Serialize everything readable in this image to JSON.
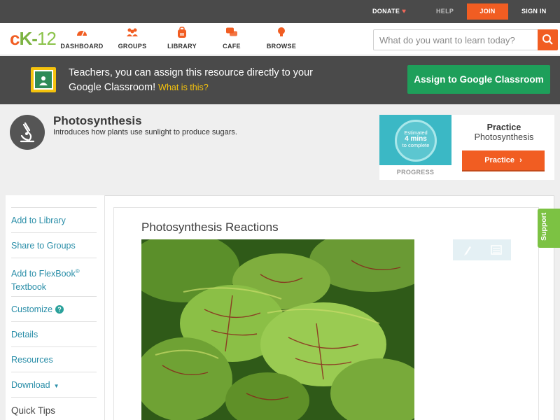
{
  "topbar": {
    "donate": "DONATE",
    "help": "HELP",
    "join": "JOIN",
    "signin": "SIGN IN"
  },
  "header": {
    "nav": [
      {
        "label": "DASHBOARD",
        "icon": "speedometer-icon"
      },
      {
        "label": "GROUPS",
        "icon": "people-icon"
      },
      {
        "label": "LIBRARY",
        "icon": "backpack-icon"
      },
      {
        "label": "CAFE",
        "icon": "chat-bubbles-icon"
      },
      {
        "label": "BROWSE",
        "icon": "lightbulb-icon"
      }
    ],
    "search_placeholder": "What do you want to learn today?"
  },
  "banner": {
    "text": "Teachers, you can assign this resource directly to your Google Classroom!",
    "link": "What is this?",
    "assign_button": "Assign to Google Classroom"
  },
  "concept": {
    "title": "Photosynthesis",
    "description": "Introduces how plants use sunlight to produce sugars."
  },
  "practice": {
    "estimate_line1": "Estimated",
    "estimate_mins": "4 mins",
    "estimate_line3": "to complete",
    "progress_label": "PROGRESS",
    "title": "Practice",
    "subtitle": "Photosynthesis",
    "button": "Practice"
  },
  "sidebar": {
    "add_library": "Add to Library",
    "share_groups": "Share to Groups",
    "flexbook_line1": "Add to FlexBook",
    "flexbook_reg": "®",
    "flexbook_line2": "Textbook",
    "customize": "Customize",
    "details": "Details",
    "resources": "Resources",
    "download": "Download",
    "quick_tips": "Quick Tips"
  },
  "lesson": {
    "title": "Photosynthesis Reactions"
  },
  "support": "Support",
  "colors": {
    "brand_orange": "#f15d22",
    "brand_green": "#7cb342",
    "classroom_green": "#1e9f5a",
    "link_teal": "#2a8ea8"
  }
}
